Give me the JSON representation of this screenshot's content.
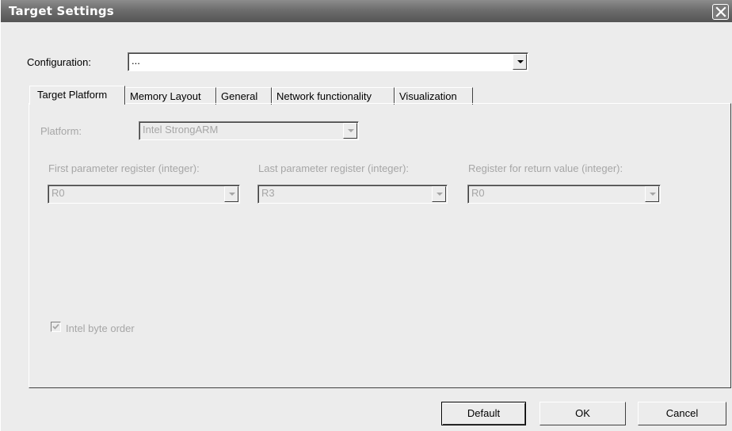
{
  "window": {
    "title": "Target Settings",
    "close_icon": "close-icon"
  },
  "configuration": {
    "label": "Configuration:",
    "value": "..."
  },
  "tabs": [
    {
      "label": "Target Platform",
      "active": true
    },
    {
      "label": "Memory Layout",
      "active": false
    },
    {
      "label": "General",
      "active": false
    },
    {
      "label": "Network functionality",
      "active": false
    },
    {
      "label": "Visualization",
      "active": false
    }
  ],
  "platform": {
    "label": "Platform:",
    "value": "Intel StrongARM"
  },
  "first_param": {
    "label": "First parameter register (integer):",
    "value": "R0"
  },
  "last_param": {
    "label": "Last parameter register (integer):",
    "value": "R3"
  },
  "return_reg": {
    "label": "Register for return value (integer):",
    "value": "R0"
  },
  "byte_order": {
    "label": "Intel byte order",
    "checked": true
  },
  "buttons": {
    "default": "Default",
    "ok": "OK",
    "cancel": "Cancel"
  }
}
